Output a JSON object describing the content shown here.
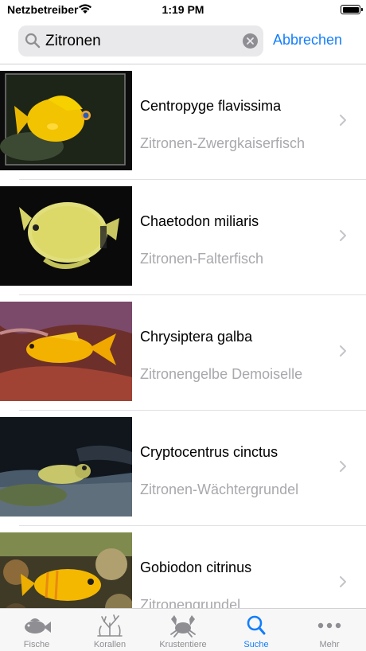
{
  "status_bar": {
    "carrier": "Netzbetreiber",
    "time": "1:19 PM"
  },
  "search": {
    "query": "Zitronen",
    "cancel_label": "Abbrechen"
  },
  "results": [
    {
      "scientific_name": "Centropyge flavissima",
      "common_name": "Zitronen-Zwergkaiserfisch"
    },
    {
      "scientific_name": "Chaetodon miliaris",
      "common_name": "Zitronen-Falterfisch"
    },
    {
      "scientific_name": "Chrysiptera galba",
      "common_name": "Zitronengelbe Demoiselle"
    },
    {
      "scientific_name": "Cryptocentrus cinctus",
      "common_name": "Zitronen-Wächtergrundel"
    },
    {
      "scientific_name": "Gobiodon citrinus",
      "common_name": "Zitronengrundel"
    }
  ],
  "tab_bar": {
    "tabs": [
      {
        "label": "Fische",
        "icon": "fish-icon"
      },
      {
        "label": "Korallen",
        "icon": "coral-icon"
      },
      {
        "label": "Krustentiere",
        "icon": "crab-icon"
      },
      {
        "label": "Suche",
        "icon": "search-icon"
      },
      {
        "label": "Mehr",
        "icon": "more-icon"
      }
    ],
    "active": "Suche"
  },
  "colors": {
    "accent": "#147efb",
    "secondary_text": "#a8a8ad",
    "inactive_tab": "#8e8e93"
  }
}
